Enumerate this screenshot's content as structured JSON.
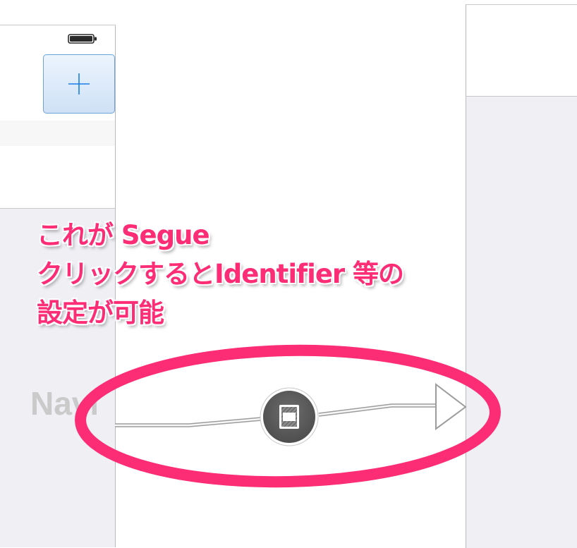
{
  "annotation": {
    "lines": [
      "これが Segue",
      "クリックするとIdentifier 等の",
      "設定が可能"
    ],
    "color": "#fc2c75"
  },
  "left_scene": {
    "toolbar_button_icon": "plus-icon",
    "status_icon": "battery-icon",
    "accent": "#1a7ee6"
  },
  "segue": {
    "icon": "segue-icon",
    "highlight_color": "#fc2c75"
  },
  "right_scene": {
    "title": "Navi"
  }
}
